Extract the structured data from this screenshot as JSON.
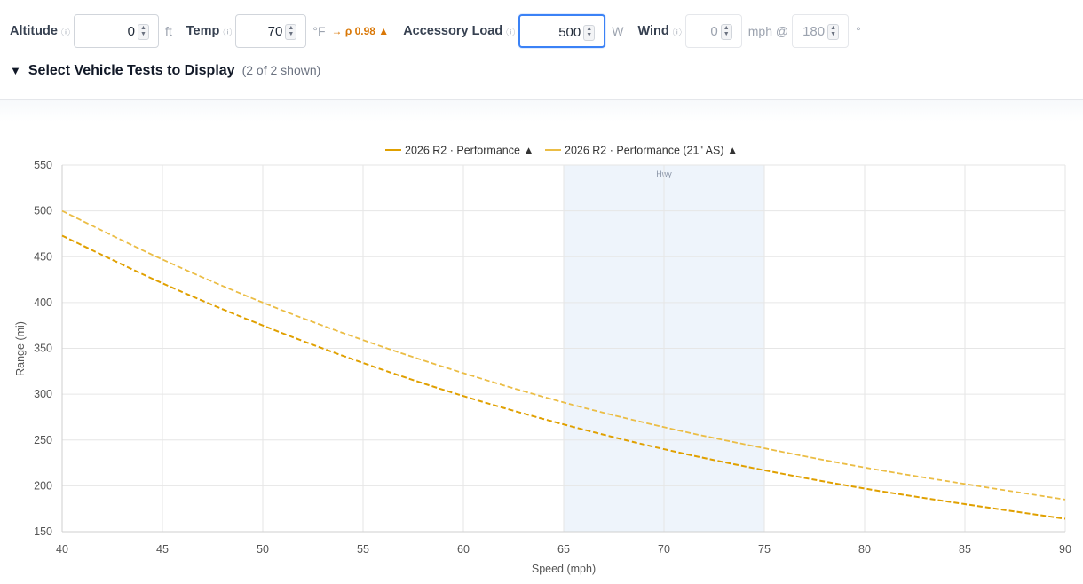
{
  "controls": {
    "altitude": {
      "label": "Altitude",
      "info_icon": "ⓘ",
      "value": "0",
      "unit": "ft"
    },
    "temp": {
      "label": "Temp",
      "info_icon": "ⓘ",
      "value": "70",
      "unit": "°F",
      "density_note": "→ ρ 0.98 ▲"
    },
    "accessory": {
      "label": "Accessory Load",
      "info_icon": "ⓘ",
      "value": "500",
      "unit": "W"
    },
    "wind": {
      "label": "Wind",
      "info_icon": "ⓘ",
      "speed_value": "0",
      "speed_unit": "mph @",
      "direction_value": "180",
      "direction_unit": "°"
    }
  },
  "vehicle_select": {
    "toggle_icon": "▼",
    "title": "Select Vehicle Tests to Display",
    "count": "(2 of 2 shown)"
  },
  "chart_data": {
    "type": "line",
    "xlabel": "Speed (mph)",
    "ylabel": "Range (mi)",
    "xlim": [
      40,
      90
    ],
    "ylim": [
      150,
      550
    ],
    "xticks": [
      40,
      45,
      50,
      55,
      60,
      65,
      70,
      75,
      80,
      85,
      90
    ],
    "yticks": [
      150,
      200,
      250,
      300,
      350,
      400,
      450,
      500,
      550
    ],
    "grid": true,
    "legend_position": "top-center",
    "highlight_band": {
      "label": "Hwy",
      "x_range": [
        65,
        75
      ],
      "color": "#eef4fb"
    },
    "series": [
      {
        "name": "2026 R2 · Performance ▲",
        "color": "#e0a000",
        "dashed": true,
        "x": [
          40,
          45,
          50,
          55,
          60,
          65,
          70,
          75,
          80,
          85,
          90
        ],
        "y": [
          473,
          421,
          375,
          334,
          298,
          267,
          240,
          217,
          197,
          180,
          164
        ]
      },
      {
        "name": "2026 R2 · Performance (21\" AS) ▲",
        "color": "#ebbd45",
        "dashed": true,
        "x": [
          40,
          45,
          50,
          55,
          60,
          65,
          70,
          75,
          80,
          85,
          90
        ],
        "y": [
          500,
          447,
          400,
          359,
          323,
          291,
          264,
          241,
          220,
          202,
          185
        ]
      }
    ]
  }
}
